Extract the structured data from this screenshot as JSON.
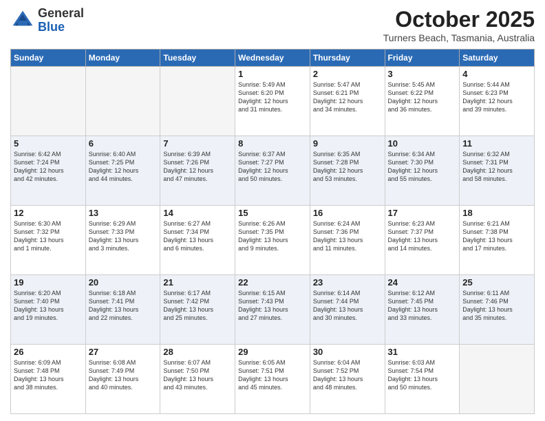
{
  "header": {
    "logo_line1": "General",
    "logo_line2": "Blue",
    "month": "October 2025",
    "location": "Turners Beach, Tasmania, Australia"
  },
  "weekdays": [
    "Sunday",
    "Monday",
    "Tuesday",
    "Wednesday",
    "Thursday",
    "Friday",
    "Saturday"
  ],
  "weeks": [
    [
      {
        "day": "",
        "info": ""
      },
      {
        "day": "",
        "info": ""
      },
      {
        "day": "",
        "info": ""
      },
      {
        "day": "1",
        "info": "Sunrise: 5:49 AM\nSunset: 6:20 PM\nDaylight: 12 hours\nand 31 minutes."
      },
      {
        "day": "2",
        "info": "Sunrise: 5:47 AM\nSunset: 6:21 PM\nDaylight: 12 hours\nand 34 minutes."
      },
      {
        "day": "3",
        "info": "Sunrise: 5:45 AM\nSunset: 6:22 PM\nDaylight: 12 hours\nand 36 minutes."
      },
      {
        "day": "4",
        "info": "Sunrise: 5:44 AM\nSunset: 6:23 PM\nDaylight: 12 hours\nand 39 minutes."
      }
    ],
    [
      {
        "day": "5",
        "info": "Sunrise: 6:42 AM\nSunset: 7:24 PM\nDaylight: 12 hours\nand 42 minutes."
      },
      {
        "day": "6",
        "info": "Sunrise: 6:40 AM\nSunset: 7:25 PM\nDaylight: 12 hours\nand 44 minutes."
      },
      {
        "day": "7",
        "info": "Sunrise: 6:39 AM\nSunset: 7:26 PM\nDaylight: 12 hours\nand 47 minutes."
      },
      {
        "day": "8",
        "info": "Sunrise: 6:37 AM\nSunset: 7:27 PM\nDaylight: 12 hours\nand 50 minutes."
      },
      {
        "day": "9",
        "info": "Sunrise: 6:35 AM\nSunset: 7:28 PM\nDaylight: 12 hours\nand 53 minutes."
      },
      {
        "day": "10",
        "info": "Sunrise: 6:34 AM\nSunset: 7:30 PM\nDaylight: 12 hours\nand 55 minutes."
      },
      {
        "day": "11",
        "info": "Sunrise: 6:32 AM\nSunset: 7:31 PM\nDaylight: 12 hours\nand 58 minutes."
      }
    ],
    [
      {
        "day": "12",
        "info": "Sunrise: 6:30 AM\nSunset: 7:32 PM\nDaylight: 13 hours\nand 1 minute."
      },
      {
        "day": "13",
        "info": "Sunrise: 6:29 AM\nSunset: 7:33 PM\nDaylight: 13 hours\nand 3 minutes."
      },
      {
        "day": "14",
        "info": "Sunrise: 6:27 AM\nSunset: 7:34 PM\nDaylight: 13 hours\nand 6 minutes."
      },
      {
        "day": "15",
        "info": "Sunrise: 6:26 AM\nSunset: 7:35 PM\nDaylight: 13 hours\nand 9 minutes."
      },
      {
        "day": "16",
        "info": "Sunrise: 6:24 AM\nSunset: 7:36 PM\nDaylight: 13 hours\nand 11 minutes."
      },
      {
        "day": "17",
        "info": "Sunrise: 6:23 AM\nSunset: 7:37 PM\nDaylight: 13 hours\nand 14 minutes."
      },
      {
        "day": "18",
        "info": "Sunrise: 6:21 AM\nSunset: 7:38 PM\nDaylight: 13 hours\nand 17 minutes."
      }
    ],
    [
      {
        "day": "19",
        "info": "Sunrise: 6:20 AM\nSunset: 7:40 PM\nDaylight: 13 hours\nand 19 minutes."
      },
      {
        "day": "20",
        "info": "Sunrise: 6:18 AM\nSunset: 7:41 PM\nDaylight: 13 hours\nand 22 minutes."
      },
      {
        "day": "21",
        "info": "Sunrise: 6:17 AM\nSunset: 7:42 PM\nDaylight: 13 hours\nand 25 minutes."
      },
      {
        "day": "22",
        "info": "Sunrise: 6:15 AM\nSunset: 7:43 PM\nDaylight: 13 hours\nand 27 minutes."
      },
      {
        "day": "23",
        "info": "Sunrise: 6:14 AM\nSunset: 7:44 PM\nDaylight: 13 hours\nand 30 minutes."
      },
      {
        "day": "24",
        "info": "Sunrise: 6:12 AM\nSunset: 7:45 PM\nDaylight: 13 hours\nand 33 minutes."
      },
      {
        "day": "25",
        "info": "Sunrise: 6:11 AM\nSunset: 7:46 PM\nDaylight: 13 hours\nand 35 minutes."
      }
    ],
    [
      {
        "day": "26",
        "info": "Sunrise: 6:09 AM\nSunset: 7:48 PM\nDaylight: 13 hours\nand 38 minutes."
      },
      {
        "day": "27",
        "info": "Sunrise: 6:08 AM\nSunset: 7:49 PM\nDaylight: 13 hours\nand 40 minutes."
      },
      {
        "day": "28",
        "info": "Sunrise: 6:07 AM\nSunset: 7:50 PM\nDaylight: 13 hours\nand 43 minutes."
      },
      {
        "day": "29",
        "info": "Sunrise: 6:05 AM\nSunset: 7:51 PM\nDaylight: 13 hours\nand 45 minutes."
      },
      {
        "day": "30",
        "info": "Sunrise: 6:04 AM\nSunset: 7:52 PM\nDaylight: 13 hours\nand 48 minutes."
      },
      {
        "day": "31",
        "info": "Sunrise: 6:03 AM\nSunset: 7:54 PM\nDaylight: 13 hours\nand 50 minutes."
      },
      {
        "day": "",
        "info": ""
      }
    ]
  ]
}
